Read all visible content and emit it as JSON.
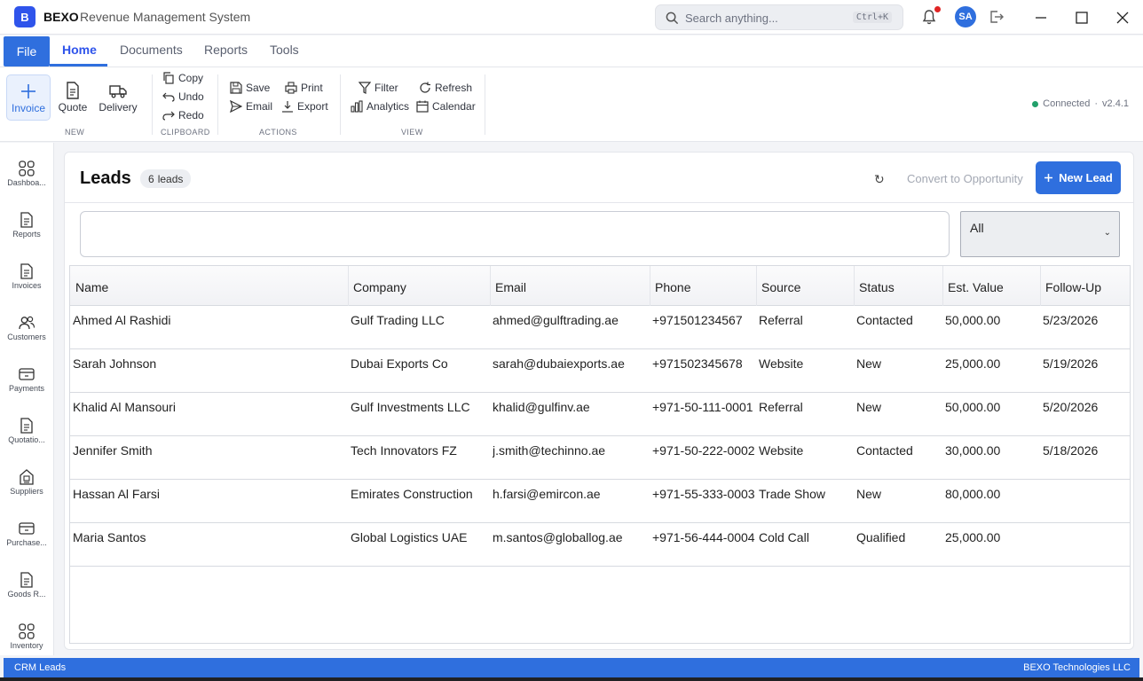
{
  "app": {
    "logo_letter": "B",
    "name": "BEXO",
    "subtitle": "Revenue Management System"
  },
  "search": {
    "placeholder": "Search anything...",
    "shortcut": "Ctrl+K"
  },
  "user": {
    "initials": "SA"
  },
  "menu": {
    "file_label": "File",
    "tabs": [
      "Home",
      "Documents",
      "Reports",
      "Tools"
    ],
    "active_tab": "Home"
  },
  "ribbon": {
    "new_group": {
      "label": "NEW",
      "invoice": "Invoice",
      "quote": "Quote",
      "delivery": "Delivery"
    },
    "clipboard_group": {
      "label": "CLIPBOARD",
      "copy": "Copy",
      "undo": "Undo",
      "redo": "Redo"
    },
    "actions_group": {
      "label": "ACTIONS",
      "save": "Save",
      "print": "Print",
      "email": "Email",
      "export": "Export"
    },
    "view_group": {
      "label": "VIEW",
      "filter": "Filter",
      "refresh": "Refresh",
      "analytics": "Analytics",
      "calendar": "Calendar"
    },
    "connection": {
      "status": "Connected",
      "separator": "·",
      "version": "v2.4.1",
      "color": "#22a06b"
    }
  },
  "sidebar": {
    "items": [
      {
        "label": "Dashboa...",
        "icon": "grid-icon"
      },
      {
        "label": "Reports",
        "icon": "document-icon"
      },
      {
        "label": "Invoices",
        "icon": "document-icon"
      },
      {
        "label": "Customers",
        "icon": "people-icon"
      },
      {
        "label": "Payments",
        "icon": "card-icon"
      },
      {
        "label": "Quotatio...",
        "icon": "document-icon"
      },
      {
        "label": "Suppliers",
        "icon": "building-icon"
      },
      {
        "label": "Purchase...",
        "icon": "card-icon"
      },
      {
        "label": "Goods R...",
        "icon": "document-icon"
      },
      {
        "label": "Inventory",
        "icon": "grid-icon"
      }
    ]
  },
  "leads": {
    "title": "Leads",
    "count": "6",
    "count_unit": "leads",
    "refresh_glyph": "↻",
    "convert_label": "Convert to Opportunity",
    "new_lead_label": "New Lead",
    "filter_value": "",
    "status_filter": "All",
    "columns": [
      "Name",
      "Company",
      "Email",
      "Phone",
      "Source",
      "Status",
      "Est. Value",
      "Follow-Up"
    ],
    "rows": [
      [
        "Ahmed Al Rashidi",
        "Gulf Trading LLC",
        "ahmed@gulftrading.ae",
        "+971501234567",
        "Referral",
        "Contacted",
        "50,000.00",
        "5/23/2026"
      ],
      [
        "Sarah Johnson",
        "Dubai Exports Co",
        "sarah@dubaiexports.ae",
        "+971502345678",
        "Website",
        "New",
        "25,000.00",
        "5/19/2026"
      ],
      [
        "Khalid Al Mansouri",
        "Gulf Investments LLC",
        "khalid@gulfinv.ae",
        "+971-50-111-0001",
        "Referral",
        "New",
        "50,000.00",
        "5/20/2026"
      ],
      [
        "Jennifer Smith",
        "Tech Innovators FZ",
        "j.smith@techinno.ae",
        "+971-50-222-0002",
        "Website",
        "Contacted",
        "30,000.00",
        "5/18/2026"
      ],
      [
        "Hassan Al Farsi",
        "Emirates Construction",
        "h.farsi@emircon.ae",
        "+971-55-333-0003",
        "Trade Show",
        "New",
        "80,000.00",
        ""
      ],
      [
        "Maria Santos",
        "Global Logistics UAE",
        "m.santos@globallog.ae",
        "+971-56-444-0004",
        "Cold Call",
        "Qualified",
        "25,000.00",
        ""
      ]
    ]
  },
  "statusbar": {
    "left": "CRM Leads",
    "right": "BEXO Technologies LLC"
  },
  "colors": {
    "accent": "#2f6fde",
    "brand": "#2f54eb"
  }
}
